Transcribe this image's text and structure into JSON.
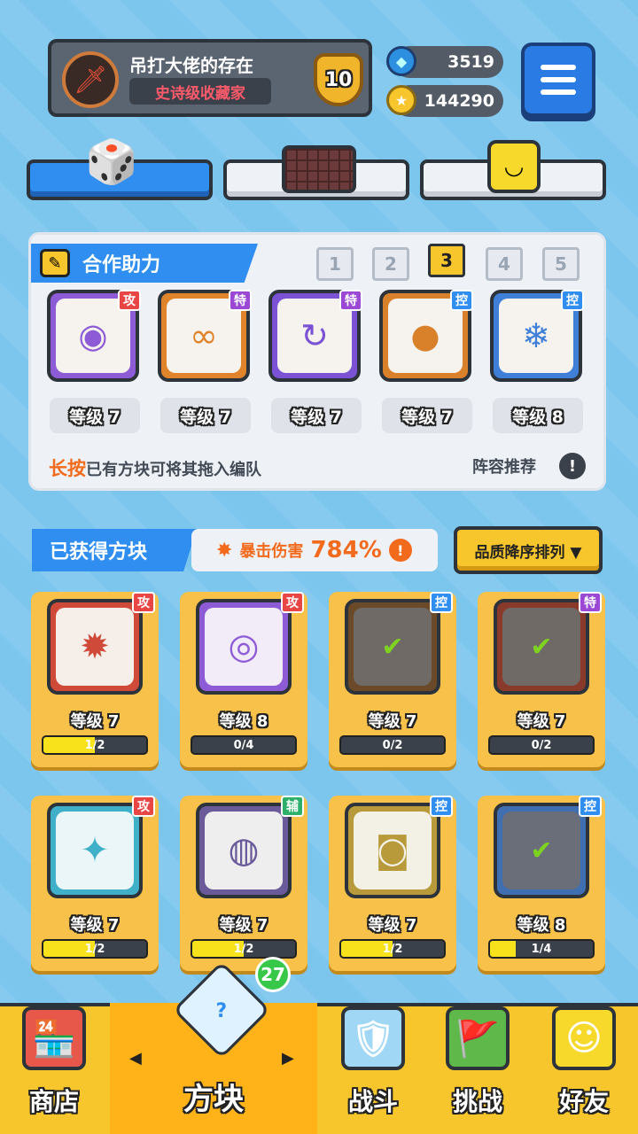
{
  "profile": {
    "name": "吊打大佬的存在",
    "title": "史诗级收藏家",
    "rank": "10"
  },
  "currency": {
    "gems": "3519",
    "coins": "144290"
  },
  "category_tabs": [
    {
      "icon": "dice-icon",
      "selected": true
    },
    {
      "icon": "board-icon",
      "selected": false
    },
    {
      "icon": "smiley-block-icon",
      "selected": false
    }
  ],
  "team": {
    "tab_label": "合作助力",
    "slots": [
      "1",
      "2",
      "3",
      "4",
      "5"
    ],
    "selected_slot": "3",
    "members": [
      {
        "badge": "攻",
        "badge_color": "#e84545",
        "level": "等级 7",
        "theme": "#8e5bd6",
        "icon": "◉"
      },
      {
        "badge": "特",
        "badge_color": "#9b48d4",
        "level": "等级 7",
        "theme": "#e0842c",
        "icon": "∞"
      },
      {
        "badge": "特",
        "badge_color": "#9b48d4",
        "level": "等级 7",
        "theme": "#7b52d4",
        "icon": "↻"
      },
      {
        "badge": "控",
        "badge_color": "#2f8ef0",
        "level": "等级 7",
        "theme": "#d8812a",
        "icon": "●"
      },
      {
        "badge": "控",
        "badge_color": "#2f8ef0",
        "level": "等级 8",
        "theme": "#3f7fd8",
        "icon": "❄"
      }
    ],
    "tip_strong": "长按",
    "tip_text": "已有方块可将其拖入编队",
    "recommend": "阵容推荐"
  },
  "owned": {
    "title": "已获得方块",
    "crit_label": "暴击伤害",
    "crit_value": "784%",
    "sort_label": "品质降序排列 ▼"
  },
  "cards": [
    {
      "badge": "攻",
      "badge_color": "#e84545",
      "level": "等级 7",
      "progress": "1/2",
      "fill": 0.5,
      "theme": "#d04a3a",
      "inner": "#f6efe9",
      "icon": "✹",
      "check": false
    },
    {
      "badge": "攻",
      "badge_color": "#e84545",
      "level": "等级 8",
      "progress": "0/4",
      "fill": 0,
      "theme": "#8e5bd6",
      "inner": "#f1ecf7",
      "icon": "◎",
      "check": false
    },
    {
      "badge": "控",
      "badge_color": "#2f8ef0",
      "level": "等级 7",
      "progress": "0/2",
      "fill": 0,
      "theme": "#6b4a2a",
      "inner": "#6f6a66",
      "icon": "●",
      "check": true
    },
    {
      "badge": "特",
      "badge_color": "#9b48d4",
      "level": "等级 7",
      "progress": "0/2",
      "fill": 0,
      "theme": "#8a3a2a",
      "inner": "#6f6a66",
      "icon": "∞",
      "check": true
    },
    {
      "badge": "攻",
      "badge_color": "#e84545",
      "level": "等级 7",
      "progress": "1/2",
      "fill": 0.5,
      "theme": "#3fb0c8",
      "inner": "#eaf6f8",
      "icon": "✦",
      "check": false
    },
    {
      "badge": "辅",
      "badge_color": "#2fb06a",
      "level": "等级 7",
      "progress": "1/2",
      "fill": 0.5,
      "theme": "#6a5a9a",
      "inner": "#eeeeee",
      "icon": "◍",
      "check": false
    },
    {
      "badge": "控",
      "badge_color": "#2f8ef0",
      "level": "等级 7",
      "progress": "1/2",
      "fill": 0.5,
      "theme": "#b89a3a",
      "inner": "#f3f0e6",
      "icon": "◙",
      "check": false
    },
    {
      "badge": "控",
      "badge_color": "#2f8ef0",
      "level": "等级 8",
      "progress": "1/4",
      "fill": 0.25,
      "theme": "#3f6fb0",
      "inner": "#6a6e78",
      "icon": "❄",
      "check": true
    }
  ],
  "nav": {
    "count": "27",
    "items": [
      {
        "label": "商店",
        "icon": "shop-icon"
      },
      {
        "label": "方块",
        "icon": "block-icon"
      },
      {
        "label": "战斗",
        "icon": "battle-icon"
      },
      {
        "label": "挑战",
        "icon": "challenge-icon"
      },
      {
        "label": "好友",
        "icon": "friends-icon"
      }
    ],
    "selected": "方块"
  }
}
